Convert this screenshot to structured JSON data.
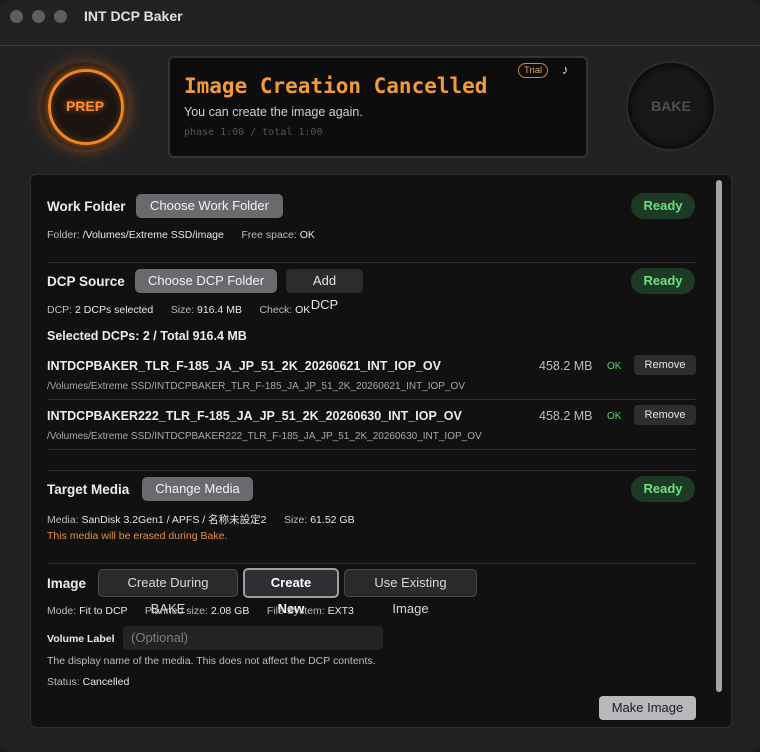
{
  "window": {
    "title": "INT DCP Baker"
  },
  "knobs": {
    "prep": "PREP",
    "bake": "BAKE"
  },
  "display": {
    "title": "Image Creation Cancelled",
    "subtitle": "You can create the image again.",
    "phase": "phase 1:00 / total 1:00",
    "badge": "Trial",
    "music_icon": "music-note-icon"
  },
  "work_folder": {
    "label": "Work Folder",
    "button": "Choose Work Folder",
    "status": "Ready",
    "folder_key": "Folder:",
    "folder_value": "/Volumes/Extreme SSD/image",
    "free_key": "Free space:",
    "free_value": "OK"
  },
  "dcp_source": {
    "label": "DCP Source",
    "choose_button": "Choose DCP Folder",
    "add_button": "Add DCP",
    "status": "Ready",
    "dcp_key": "DCP:",
    "dcp_value": "2 DCPs selected",
    "size_key": "Size:",
    "size_value": "916.4 MB",
    "check_key": "Check:",
    "check_value": "OK",
    "selected_summary": "Selected DCPs: 2 / Total 916.4 MB",
    "items": [
      {
        "name": "INTDCPBAKER_TLR_F-185_JA_JP_51_2K_20260621_INT_IOP_OV",
        "path": "/Volumes/Extreme SSD/INTDCPBAKER_TLR_F-185_JA_JP_51_2K_20260621_INT_IOP_OV",
        "size": "458.2 MB",
        "check": "OK",
        "remove": "Remove"
      },
      {
        "name": "INTDCPBAKER222_TLR_F-185_JA_JP_51_2K_20260630_INT_IOP_OV",
        "path": "/Volumes/Extreme SSD/INTDCPBAKER222_TLR_F-185_JA_JP_51_2K_20260630_INT_IOP_OV",
        "size": "458.2 MB",
        "check": "OK",
        "remove": "Remove"
      }
    ]
  },
  "target_media": {
    "label": "Target Media",
    "button": "Change Media",
    "status": "Ready",
    "media_key": "Media:",
    "media_value": "SanDisk 3.2Gen1 / APFS / 名称未設定2",
    "size_key": "Size:",
    "size_value": "61.52 GB",
    "warning": "This media will be erased during Bake."
  },
  "image": {
    "label": "Image",
    "options": [
      "Create During BAKE",
      "Create New",
      "Use Existing Image"
    ],
    "selected": "Create New",
    "mode_key": "Mode:",
    "mode_value": "Fit to DCP",
    "planned_key": "Planned size:",
    "planned_value": "2.08 GB",
    "fs_key": "File System:",
    "fs_value": "EXT3",
    "volume_label": "Volume Label",
    "volume_placeholder": "(Optional)",
    "volume_help": "The display name of the media. This does not affect the DCP contents.",
    "status_key": "Status:",
    "status_value": "Cancelled",
    "make_button": "Make Image"
  }
}
